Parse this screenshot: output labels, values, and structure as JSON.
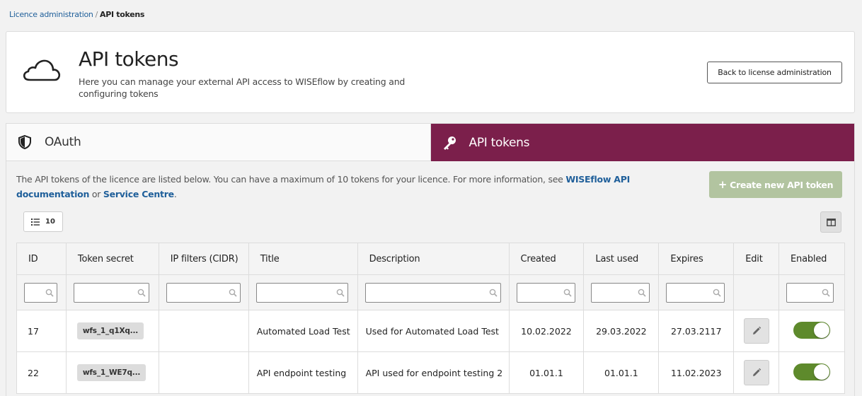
{
  "breadcrumb": {
    "parent": "Licence administration",
    "separator": "/",
    "current": "API tokens"
  },
  "header": {
    "title": "API tokens",
    "subtitle": "Here you can manage your external API access to WISEflow by creating and configuring tokens",
    "back_button": "Back to license administration",
    "icon": "cloud-icon"
  },
  "tabs": [
    {
      "label": "OAuth",
      "icon": "shield-icon",
      "active": false
    },
    {
      "label": "API tokens",
      "icon": "key-icon",
      "active": true
    }
  ],
  "colors": {
    "accent": "#7b1f4b",
    "create_button": "#b2c4a0",
    "toggle_on": "#5e8a2c",
    "link": "#1f5f9a"
  },
  "info": {
    "text": "The API tokens of the licence are listed below. You can have a maximum of 10 tokens for your licence. For more information, see ",
    "link1": "WISEflow API documentation",
    "or": " or ",
    "link2": "Service Centre",
    "end": "."
  },
  "create_button": "Create new API token",
  "page_size": "10",
  "table": {
    "columns": [
      "ID",
      "Token secret",
      "IP filters (CIDR)",
      "Title",
      "Description",
      "Created",
      "Last used",
      "Expires",
      "Edit",
      "Enabled"
    ],
    "rows": [
      {
        "id": "17",
        "token": "wfs_1_q1Xq...",
        "ip": "",
        "title": "Automated Load Test",
        "description": "Used for Automated Load Test",
        "created": "10.02.2022",
        "last_used": "29.03.2022",
        "expires": "27.03.2117",
        "enabled": true
      },
      {
        "id": "22",
        "token": "wfs_1_WE7q...",
        "ip": "",
        "title": "API endpoint testing",
        "description": "API used for endpoint testing 2",
        "created": "01.01.1",
        "last_used": "01.01.1",
        "expires": "11.02.2023",
        "enabled": true
      }
    ]
  }
}
